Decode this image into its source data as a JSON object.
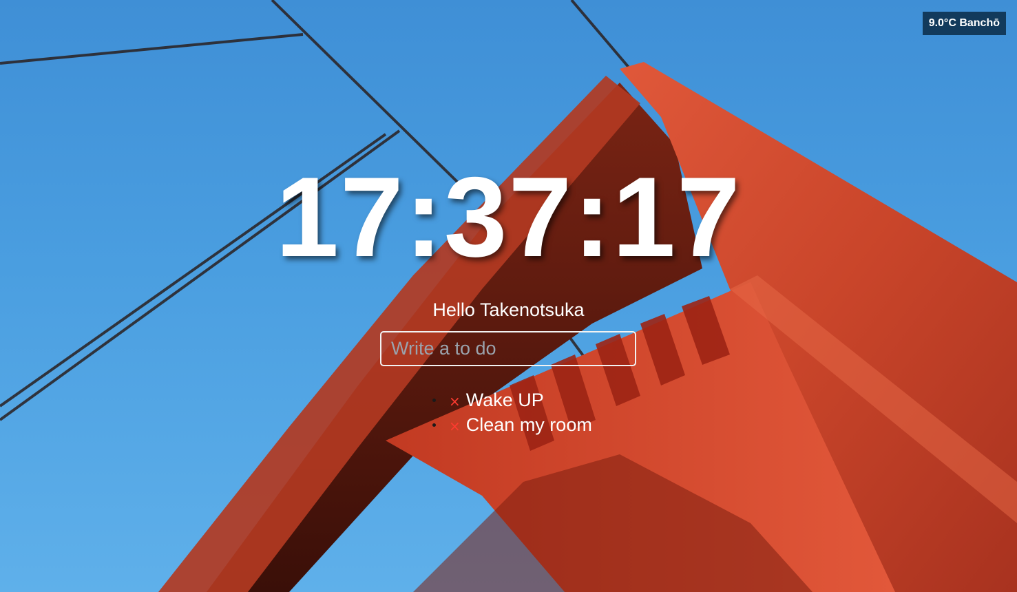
{
  "weather": {
    "text": "9.0°C Banchō"
  },
  "clock": {
    "time": "17:37:17"
  },
  "greeting": {
    "text": "Hello Takenotsuka"
  },
  "todo": {
    "placeholder": "Write a to do",
    "value": "",
    "delete_icon": "×",
    "items": [
      {
        "text": "Wake UP"
      },
      {
        "text": "Clean my room"
      }
    ]
  },
  "colors": {
    "sky": "#4a9ee0",
    "bridge": "#c8452b",
    "delete_icon": "#ff3b30",
    "weather_badge_bg": "#123a5c"
  },
  "background": {
    "subject": "red suspension bridge tower against blue sky"
  }
}
